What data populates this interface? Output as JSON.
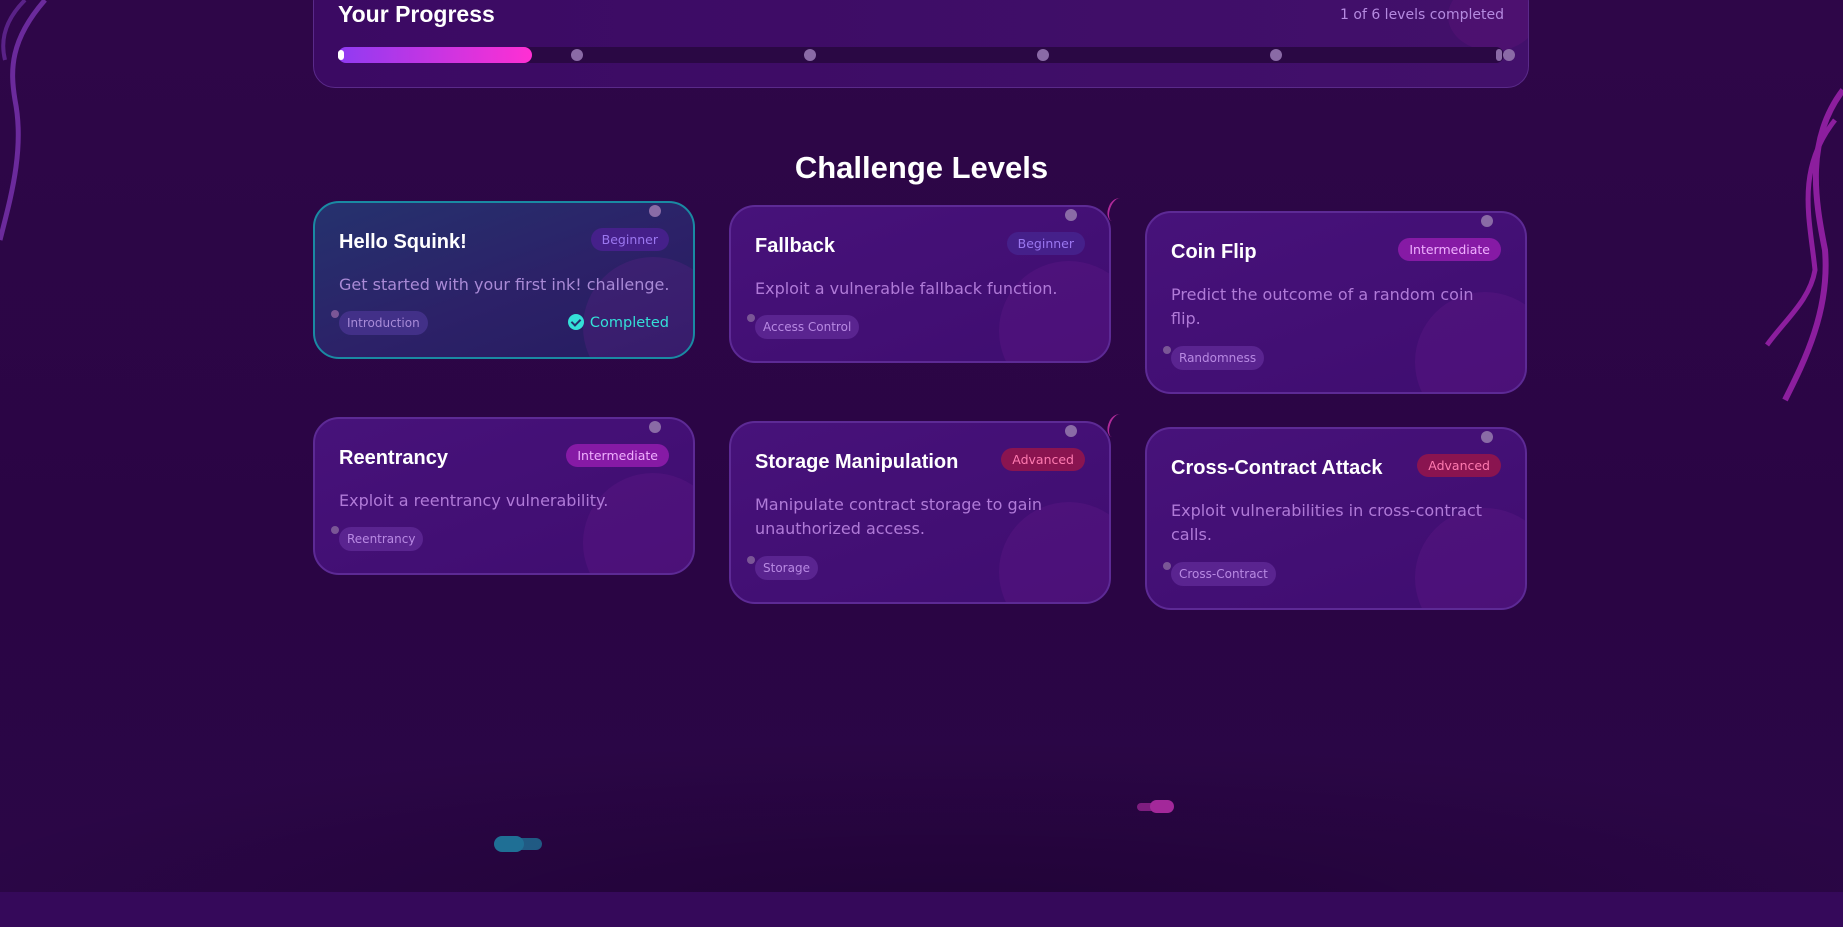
{
  "progress": {
    "title": "Your Progress",
    "count_text": "1 of 6 levels completed",
    "completed": 1,
    "total": 6,
    "fill_fraction": 0.166
  },
  "section": {
    "title": "Challenge Levels"
  },
  "levels": [
    {
      "title": "Hello Squink!",
      "difficulty": "Beginner",
      "description": "Get started with your first ink! challenge.",
      "tag": "Introduction",
      "status": "Completed"
    },
    {
      "title": "Fallback",
      "difficulty": "Beginner",
      "description": "Exploit a vulnerable fallback function.",
      "tag": "Access Control"
    },
    {
      "title": "Coin Flip",
      "difficulty": "Intermediate",
      "description": "Predict the outcome of a random coin flip.",
      "tag": "Randomness"
    },
    {
      "title": "Reentrancy",
      "difficulty": "Intermediate",
      "description": "Exploit a reentrancy vulnerability.",
      "tag": "Reentrancy"
    },
    {
      "title": "Storage Manipulation",
      "difficulty": "Advanced",
      "description": "Manipulate contract storage to gain unauthorized access.",
      "tag": "Storage"
    },
    {
      "title": "Cross-Contract Attack",
      "difficulty": "Advanced",
      "description": "Exploit vulnerabilities in cross-contract calls.",
      "tag": "Cross-Contract"
    }
  ],
  "colors": {
    "background": "#2c0646",
    "progress_gradient_start": "#8f3bf2",
    "progress_gradient_end": "#ff2fd3",
    "completed_accent": "#34e0d8",
    "beginner_badge": "#45208a",
    "intermediate_badge": "#861aa5",
    "advanced_badge": "#8a1450"
  },
  "icons": {
    "completed": "check-circle-icon"
  }
}
